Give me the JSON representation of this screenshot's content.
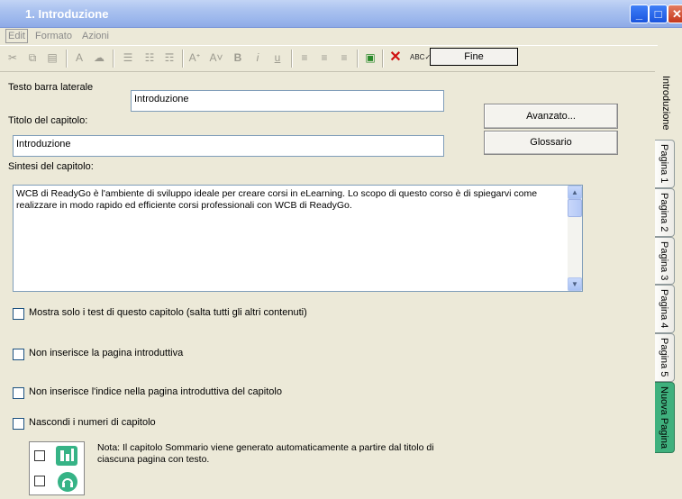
{
  "window": {
    "title": "1. Introduzione"
  },
  "menu": [
    "Edit",
    "Formato",
    "Azioni"
  ],
  "toolbar": {
    "fine_label": "Fine"
  },
  "form": {
    "sidebar_label": "Testo barra laterale",
    "sidebar_value": "Introduzione",
    "chapter_title_label": "Titolo del capitolo:",
    "chapter_title_value": "Introduzione",
    "summary_label": "Sintesi del capitolo:",
    "summary_value": "WCB di ReadyGo è l'ambiente di sviluppo ideale per creare corsi in eLearning.  Lo scopo di questo corso è di spiegarvi come realizzare in modo rapido ed efficiente corsi professionali con WCB di ReadyGo.",
    "advanced_button": "Avanzato...",
    "glossary_button": "Glossario"
  },
  "options": [
    {
      "label": "Mostra solo i test di questo capitolo (salta tutti gli altri contenuti)",
      "checked": false
    },
    {
      "label": "Non inserisce la pagina introduttiva",
      "checked": false
    },
    {
      "label": "Non inserisce l'indice nella pagina introduttiva del capitolo",
      "checked": false
    },
    {
      "label": "Nascondi i numeri di capitolo",
      "checked": false
    }
  ],
  "note": "Nota: Il capitolo Sommario viene generato automaticamente a partire dal titolo di ciascuna pagina con testo.",
  "tabs": [
    "Introduzione",
    "Pagina 1",
    "Pagina 2",
    "Pagina 3",
    "Pagina 4",
    "Pagina 5",
    "Nuova Pagina"
  ],
  "colors": {
    "titlebar": "#9cb7ec",
    "new_page_tab": "#3fb07d",
    "background": "#ece9d8"
  }
}
